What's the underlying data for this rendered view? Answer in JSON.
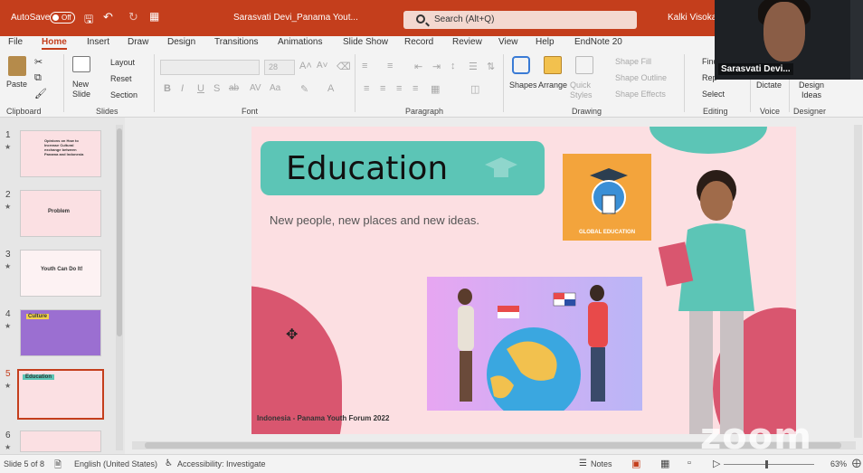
{
  "titlebar": {
    "autosave_label": "AutoSave",
    "autosave_state": "Off",
    "doc_title": "Sarasvati Devi_Panama Yout...",
    "search_placeholder": "Search (Alt+Q)",
    "user_name": "Kalki Visoka"
  },
  "tabs": [
    "File",
    "Home",
    "Insert",
    "Draw",
    "Design",
    "Transitions",
    "Animations",
    "Slide Show",
    "Record",
    "Review",
    "View",
    "Help",
    "EndNote 20"
  ],
  "active_tab": "Home",
  "ribbon": {
    "clipboard": {
      "paste": "Paste",
      "label": "Clipboard"
    },
    "slides": {
      "new_slide": "New Slide",
      "layout": "Layout",
      "reset": "Reset",
      "section": "Section",
      "label": "Slides"
    },
    "font": {
      "label": "Font",
      "size": "28"
    },
    "paragraph": {
      "label": "Paragraph"
    },
    "drawing": {
      "shapes": "Shapes",
      "arrange": "Arrange",
      "quick_styles": "Quick Styles",
      "shape_fill": "Shape Fill",
      "shape_outline": "Shape Outline",
      "shape_effects": "Shape Effects",
      "label": "Drawing"
    },
    "editing": {
      "find": "Find",
      "replace": "Rep",
      "select": "Select",
      "label": "Editing"
    },
    "voice": {
      "dictate": "Dictate",
      "label": "Voice"
    },
    "designer": {
      "design_ideas": "Design Ideas",
      "label": "Designer"
    }
  },
  "thumbnails": [
    {
      "num": "1",
      "label": "Opinions on How to Increase Cultural exchange between Panama and Indonesia"
    },
    {
      "num": "2",
      "label": "Problem"
    },
    {
      "num": "3",
      "label": "Youth Can Do It!"
    },
    {
      "num": "4",
      "label": "Culture"
    },
    {
      "num": "5",
      "label": "Education"
    },
    {
      "num": "6",
      "label": ""
    }
  ],
  "slide": {
    "title": "Education",
    "body": "New people, new places and new ideas.",
    "badge": "GLOBAL EDUCATION",
    "footer": "Indonesia - Panama Youth Forum 2022"
  },
  "video": {
    "participant": "Sarasvati Devi..."
  },
  "watermark": "zoom",
  "statusbar": {
    "slide_info": "Slide 5 of 8",
    "language": "English (United States)",
    "accessibility": "Accessibility: Investigate",
    "notes": "Notes",
    "zoom": "63%"
  },
  "colors": {
    "accent": "#c43e1c",
    "teal": "#5cc5b6",
    "pink": "#d9566f",
    "slide_bg": "#fcdfe2"
  }
}
